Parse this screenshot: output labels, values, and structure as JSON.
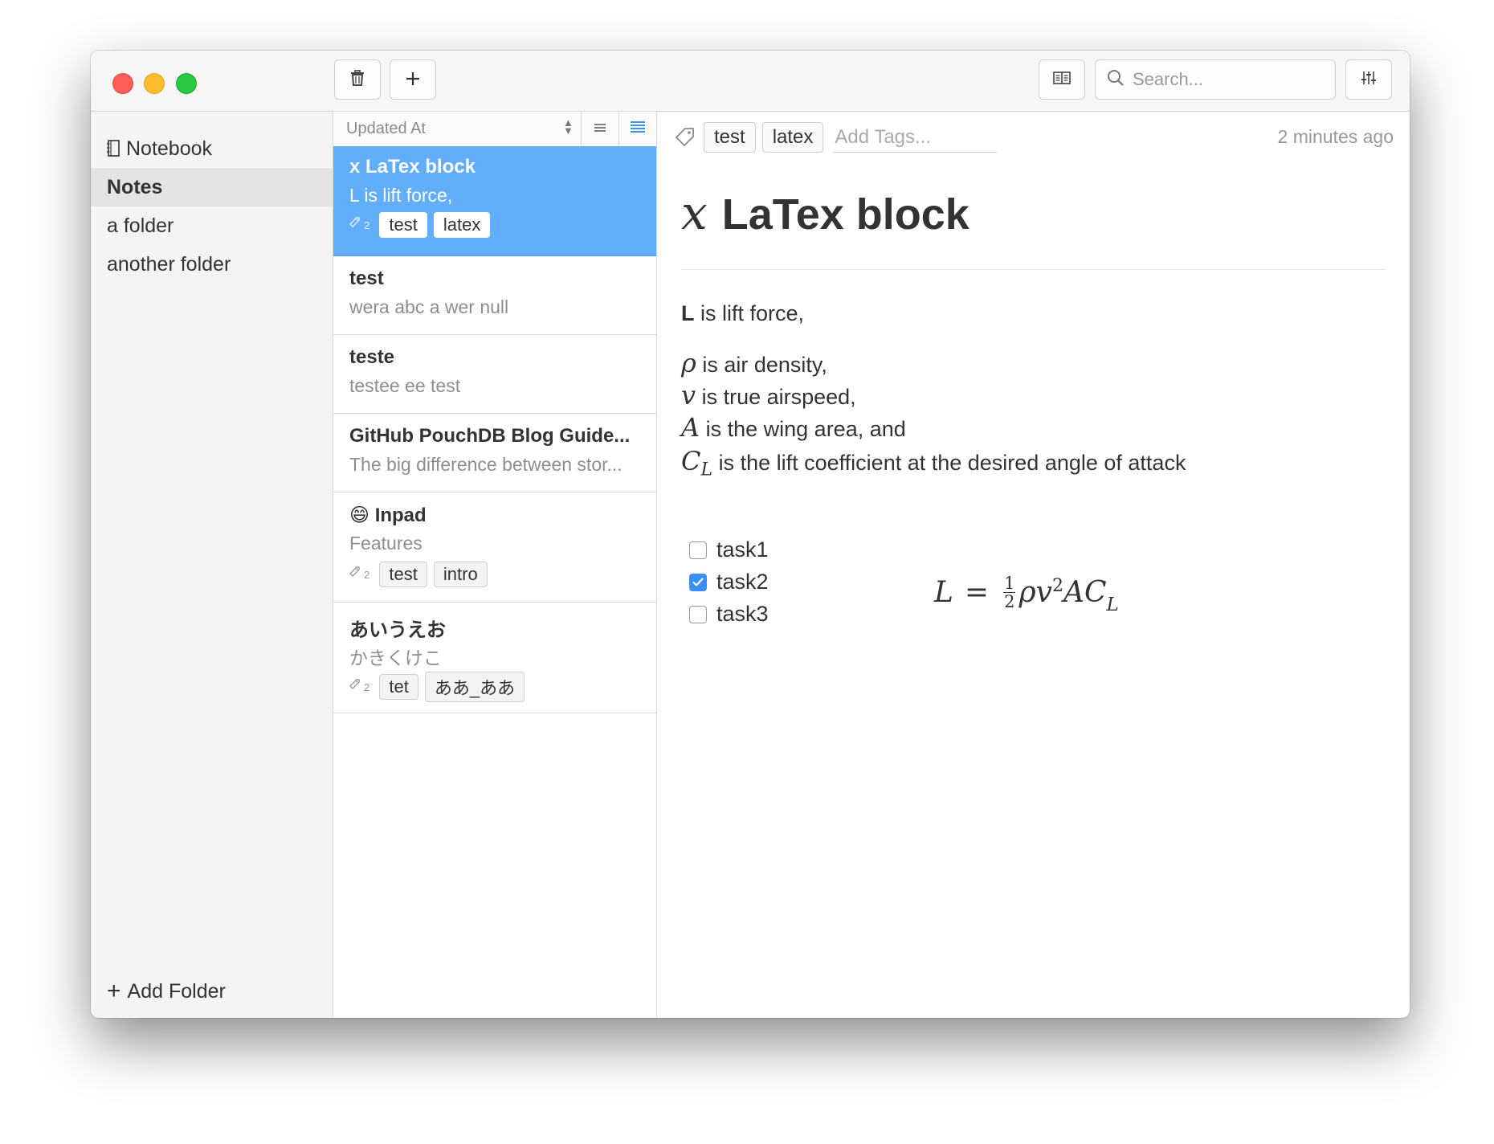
{
  "toolbar": {
    "search_placeholder": "Search..."
  },
  "sidebar": {
    "items": [
      {
        "label": "Notebook",
        "icon": "notebook-icon"
      },
      {
        "label": "Notes"
      },
      {
        "label": "a folder"
      },
      {
        "label": "another folder"
      }
    ],
    "add_folder_label": "Add Folder"
  },
  "list": {
    "sort_label": "Updated At",
    "notes": [
      {
        "title": "x LaTex block",
        "preview": "L is lift force,",
        "tag_count": "2",
        "tags": [
          "test",
          "latex"
        ]
      },
      {
        "title": "test",
        "preview": "wera abc a wer null"
      },
      {
        "title": "teste",
        "preview": "testee ee test"
      },
      {
        "title": "GitHub PouchDB Blog Guide...",
        "preview": "The big difference between stor..."
      },
      {
        "title": "😄 Inpad",
        "preview": "Features",
        "tag_count": "2",
        "tags": [
          "test",
          "intro"
        ]
      },
      {
        "title": "あいうえお",
        "preview": "かきくけこ",
        "tag_count": "2",
        "tags": [
          "tet",
          "ああ_ああ"
        ]
      }
    ]
  },
  "editor": {
    "tags": [
      "test",
      "latex"
    ],
    "add_tags_placeholder": "Add Tags...",
    "timestamp": "2 minutes ago",
    "title_math": "x",
    "title_text": "LaTex block",
    "lines": {
      "l1_bold": "L",
      "l1_text": " is lift force,",
      "rho_sym": "ρ",
      "rho_text": " is air density,",
      "v_sym": "v",
      "v_text": " is true airspeed,",
      "a_sym": "A",
      "a_text": " is the wing area, and",
      "c_sym": "C",
      "c_sub": "L",
      "c_text": " is the lift coefficient at the desired angle of attack"
    },
    "equation": {
      "lhs": "L",
      "eq": "=",
      "num": "1",
      "den": "2",
      "rhs_a": "ρv",
      "rhs_sup": "2",
      "rhs_b": "AC",
      "rhs_sub": "L"
    },
    "tasks": [
      {
        "label": "task1",
        "checked": false
      },
      {
        "label": "task2",
        "checked": true
      },
      {
        "label": "task3",
        "checked": false
      }
    ]
  },
  "colors": {
    "accent": "#62aefc",
    "checkbox": "#3b8ff5",
    "close": "#fc5f57",
    "minimize": "#fdbc2e",
    "zoom": "#28c840"
  }
}
